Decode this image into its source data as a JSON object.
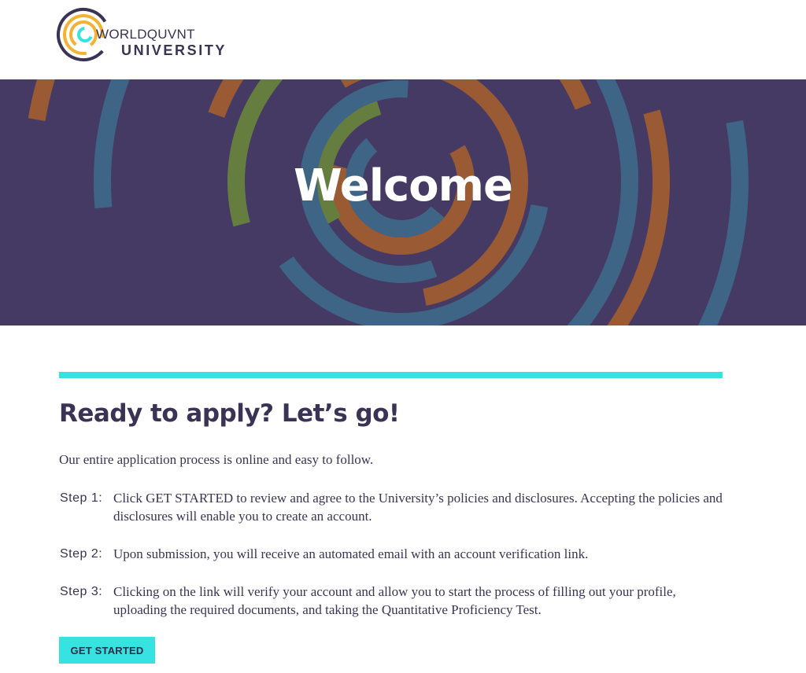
{
  "header": {
    "logo_line1": "WORLDQUVNT",
    "logo_line2": "UNIVERSITY"
  },
  "hero": {
    "title": "Welcome"
  },
  "main": {
    "title": "Ready to apply? Let’s go!",
    "intro": "Our entire application process is online and easy to follow.",
    "steps": [
      {
        "label": "Step 1:",
        "text": "Click GET STARTED to review and agree to the University’s policies and disclosures. Accepting the policies and disclosures will enable you to create an account."
      },
      {
        "label": "Step 2:",
        "text": "Upon submission, you will receive an automated email with an account verification link."
      },
      {
        "label": "Step 3:",
        "text": "Clicking on the link will verify your account and allow you to start the process of filling out your profile, uploading the required documents, and taking the Quantitative Proficiency Test."
      }
    ],
    "cta_label": "GET STARTED"
  },
  "colors": {
    "brand_purple": "#453a64",
    "accent_cyan": "#36e3e0",
    "ring_orange": "#a8602c",
    "ring_blue": "#3e6d8c",
    "logo_yellow": "#f2b233"
  }
}
